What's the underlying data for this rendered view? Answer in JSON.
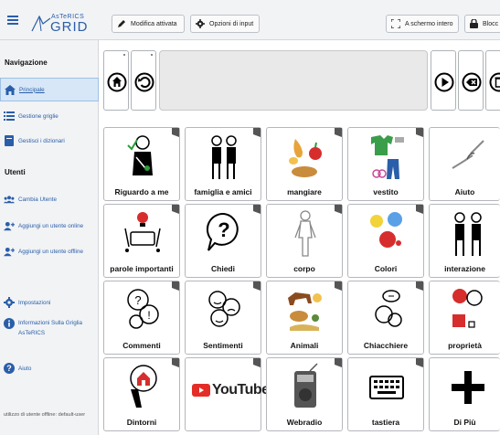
{
  "app": {
    "logo_small": "AsTeRICS",
    "logo_main": "GRID"
  },
  "toolbar": {
    "edit_mode_label": "Modifica attivata",
    "input_options_label": "Opzioni di input",
    "fullscreen_label": "A schermo intero",
    "lock_label": "Blocc"
  },
  "sidebar": {
    "nav_title": "Navigazione",
    "nav_items": [
      {
        "label": "Principale",
        "icon": "home-icon",
        "active": true
      },
      {
        "label": "Gestione griglie",
        "icon": "list-icon",
        "active": false
      },
      {
        "label": "Gestisci i dizionari",
        "icon": "book-icon",
        "active": false
      }
    ],
    "users_title": "Utenti",
    "user_items": [
      {
        "label": "Cambia Utente",
        "icon": "users-icon"
      },
      {
        "label": "Aggiungi un utente online",
        "icon": "add-user-icon"
      },
      {
        "label": "Aggiungi un utente offline",
        "icon": "add-user-icon"
      }
    ],
    "other_items": [
      {
        "label": "Impostazioni",
        "icon": "gear-icon"
      },
      {
        "label": "Informazioni Sulla Griglia AsTeRICS",
        "icon": "info-icon"
      },
      {
        "label": "Aiuto",
        "icon": "help-icon"
      }
    ],
    "footer": "utilizzo di utente offline: default-user"
  },
  "grid": {
    "cells": [
      [
        "Riguardo a me",
        "famiglia e amici",
        "mangiare",
        "vestito",
        "Aiuto"
      ],
      [
        "parole importanti",
        "Chiedi",
        "corpo",
        "Colori",
        "interazione"
      ],
      [
        "Commenti",
        "Sentimenti",
        "Animali",
        "Chiacchiere",
        "proprietà"
      ],
      [
        "Dintorni",
        "",
        "Webradio",
        "tastiera",
        "Di Più"
      ]
    ],
    "youtube_text": "YouTube"
  },
  "colors": {
    "accent": "#2a5ea8",
    "active_bg": "#d7e7f7",
    "youtube_red": "#e52d27"
  }
}
